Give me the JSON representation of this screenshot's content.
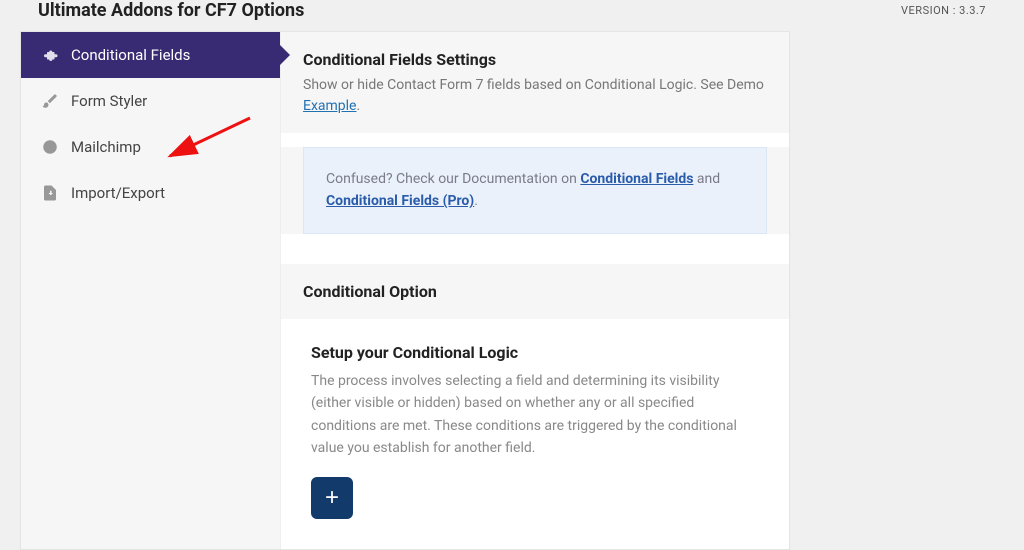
{
  "header": {
    "title": "Ultimate Addons for CF7 Options",
    "version": "VERSION : 3.3.7"
  },
  "sidebar": {
    "items": [
      {
        "label": "Conditional Fields"
      },
      {
        "label": "Form Styler"
      },
      {
        "label": "Mailchimp"
      },
      {
        "label": "Import/Export"
      }
    ]
  },
  "content": {
    "settings_title": "Conditional Fields Settings",
    "settings_desc": "Show or hide Contact Form 7 fields based on Conditional Logic. See Demo ",
    "example_link": "Example",
    "note_prefix": "Confused? Check our Documentation on ",
    "note_link1": "Conditional Fields",
    "note_and": " and ",
    "note_link2": "Conditional Fields (Pro)",
    "dot": ".",
    "option_heading": "Conditional Option",
    "setup_title": "Setup your Conditional Logic",
    "setup_desc": "The process involves selecting a field and determining its visibility (either visible or hidden) based on whether any or all specified conditions are met. These conditions are triggered by the conditional value you establish for another field.",
    "add_label": "+"
  }
}
